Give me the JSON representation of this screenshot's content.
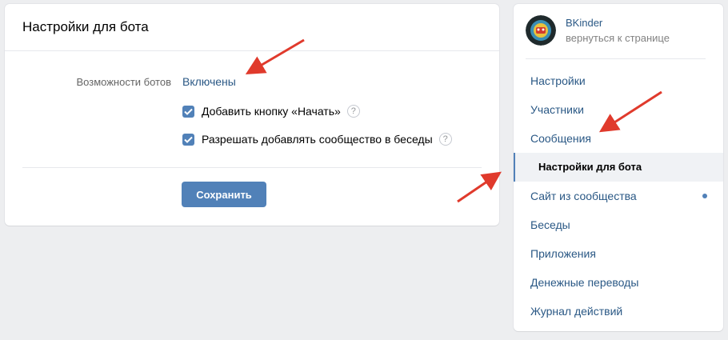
{
  "settings": {
    "title": "Настройки для бота",
    "bot_features_label": "Возможности ботов",
    "bot_features_value": "Включены",
    "options": [
      {
        "label": "Добавить кнопку «Начать»",
        "checked": true
      },
      {
        "label": "Разрешать добавлять сообщество в беседы",
        "checked": true
      }
    ],
    "help_glyph": "?",
    "save_label": "Сохранить"
  },
  "sidebar": {
    "profile_name": "BKinder",
    "profile_link": "вернуться к странице",
    "items": [
      {
        "label": "Настройки"
      },
      {
        "label": "Участники"
      },
      {
        "label": "Сообщения"
      },
      {
        "label": "Настройки для бота",
        "active": true
      },
      {
        "label": "Сайт из сообщества",
        "badge": "dot"
      },
      {
        "label": "Беседы"
      },
      {
        "label": "Приложения"
      },
      {
        "label": "Денежные переводы"
      },
      {
        "label": "Журнал действий"
      }
    ]
  },
  "colors": {
    "accent": "#5181b8",
    "link": "#2a5885",
    "annotation_arrow": "#e03a2c"
  }
}
